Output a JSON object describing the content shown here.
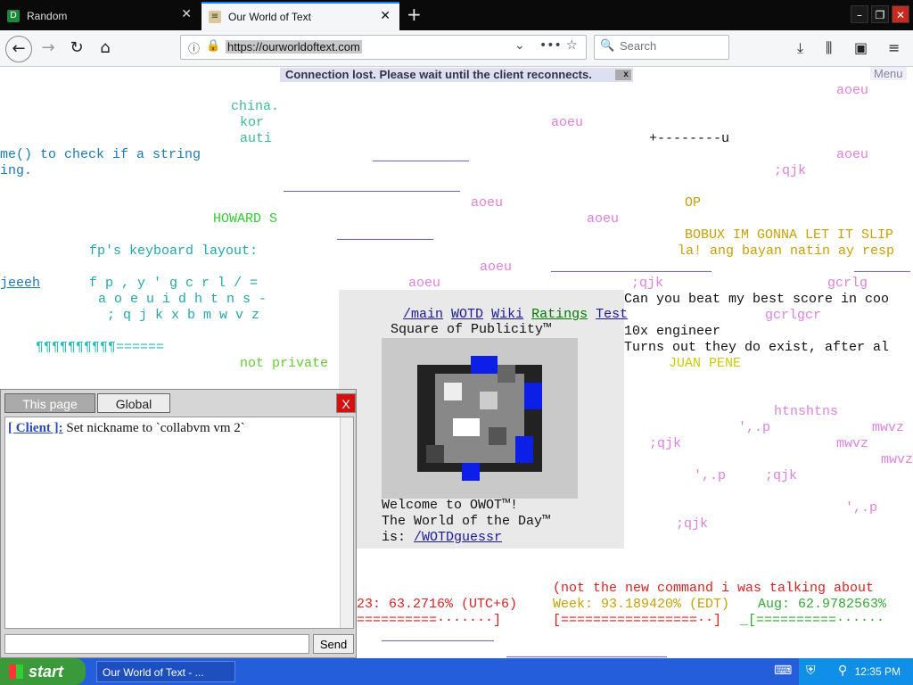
{
  "browser": {
    "tabs": [
      {
        "label": "Random",
        "active": false
      },
      {
        "label": "Our World of Text",
        "active": true
      }
    ],
    "url": "https://ourworldoftext.com",
    "search_placeholder": "Search"
  },
  "page": {
    "banner": "Connection lost. Please wait until the client reconnects.",
    "banner_close": "x",
    "menu_label": "Menu",
    "center_nav": [
      "/main",
      "WOTD",
      "Wiki",
      "Ratings",
      "Test"
    ],
    "sop_title": "Square of Publicity™",
    "welcome_lines": [
      "Welcome to OWOT™!",
      "The World of the Day™",
      "is: "
    ],
    "wotd_link": "/WOTDguessr",
    "text_fragments": [
      "china.",
      "kor",
      "auti",
      "me() to check if a string",
      "ing.",
      "HOWARD S",
      "fp's keyboard layout:",
      "jeeeh",
      "f p , y ' g c r l / =",
      "a o e u i d h t n s -",
      "; q j k x b m w v z",
      "¶¶¶¶¶¶¶¶¶¶======",
      "not private",
      "Can you beat my best score in coo",
      "10x engineer",
      "Turns out they do exist, after al",
      "JUAN PENE",
      "OP",
      "BOBUX IM GONNA LET IT SLIP",
      "la! ang bayan natin ay resp",
      "aoeu",
      ";qjk",
      "gcrlg",
      "gcrlgcr",
      "htnshtns",
      "mwvz",
      "+--------u",
      "',.p",
      "(not the new command i was talking about",
      "23: 63.2716% (UTC+6)",
      "Week: 93.189420% (EDT)",
      "Aug: 62.9782563%"
    ]
  },
  "chat": {
    "tabs": [
      "This page",
      "Global"
    ],
    "close": "X",
    "messages": [
      {
        "sender": "[ Client ]:",
        "text": "Set nickname to `collabvm vm 2`"
      }
    ],
    "send_label": "Send"
  },
  "taskbar": {
    "start": "start",
    "items": [
      "Our World of Text - ..."
    ],
    "clock": "12:35 PM"
  }
}
